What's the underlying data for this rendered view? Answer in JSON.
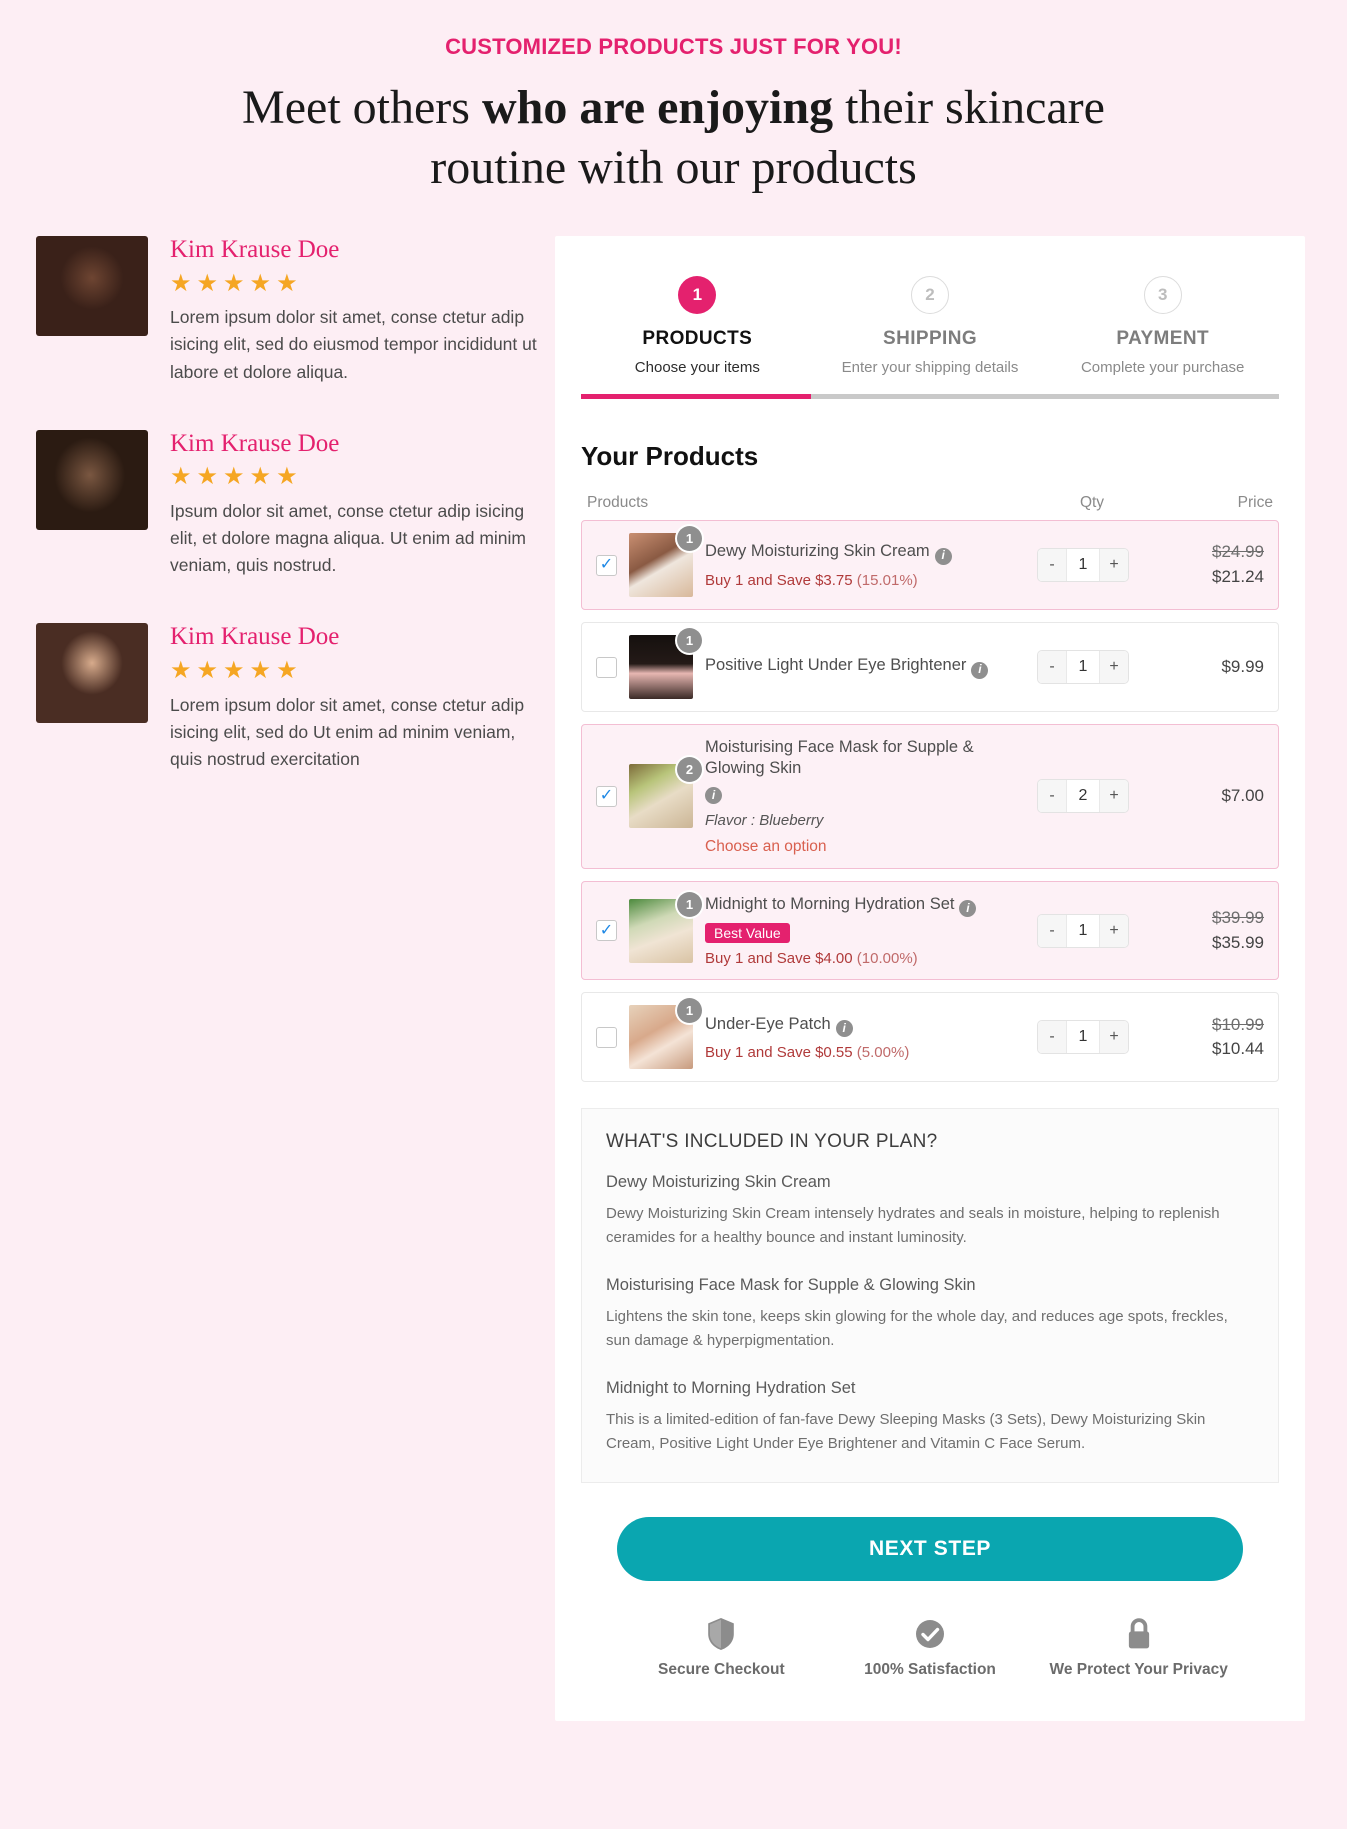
{
  "header": {
    "eyebrow": "CUSTOMIZED PRODUCTS JUST FOR YOU!",
    "headline_part1": "Meet others ",
    "headline_bold": "who are enjoying",
    "headline_part2": " their skincare routine with our products"
  },
  "testimonials": [
    {
      "name": "Kim Krause Doe",
      "stars": "★★★★★",
      "text": "Lorem ipsum dolor sit amet, conse ctetur adip isicing elit, sed do eiusmod tempor incididunt ut labore et dolore aliqua."
    },
    {
      "name": "Kim Krause Doe",
      "stars": "★★★★★",
      "text": "Ipsum dolor sit amet, conse ctetur adip isicing elit, et dolore magna aliqua. Ut enim ad minim veniam, quis nostrud."
    },
    {
      "name": "Kim Krause Doe",
      "stars": "★★★★★",
      "text": "Lorem ipsum dolor sit amet, conse ctetur adip isicing elit, sed do Ut enim ad minim veniam, quis nostrud exercitation"
    }
  ],
  "steps": [
    {
      "number": "1",
      "title": "PRODUCTS",
      "subtitle": "Choose your items"
    },
    {
      "number": "2",
      "title": "SHIPPING",
      "subtitle": "Enter your shipping details"
    },
    {
      "number": "3",
      "title": "PAYMENT",
      "subtitle": "Complete your purchase"
    }
  ],
  "progress_percent": 33,
  "products_section": {
    "title": "Your Products",
    "columns": {
      "products": "Products",
      "qty": "Qty",
      "price": "Price"
    }
  },
  "products": [
    {
      "name": "Dewy Moisturizing Skin Cream",
      "badge_qty": "1",
      "selected": true,
      "save_text": "Buy 1 and Save $3.75",
      "save_pct": "(15.01%)",
      "qty": "1",
      "price_old": "$24.99",
      "price_new": "$21.24"
    },
    {
      "name": "Positive Light Under Eye Brightener",
      "badge_qty": "1",
      "selected": false,
      "qty": "1",
      "price_new": "$9.99"
    },
    {
      "name": "Moisturising Face Mask for Supple & Glowing Skin",
      "badge_qty": "2",
      "selected": true,
      "flavor_label": "Flavor :",
      "flavor_value": "Blueberry",
      "choose_option": "Choose an option",
      "qty": "2",
      "price_new": "$7.00"
    },
    {
      "name": "Midnight to Morning Hydration Set",
      "badge_qty": "1",
      "selected": true,
      "tag": "Best Value",
      "save_text": "Buy 1 and Save $4.00",
      "save_pct": "(10.00%)",
      "qty": "1",
      "price_old": "$39.99",
      "price_new": "$35.99"
    },
    {
      "name": "Under-Eye Patch",
      "badge_qty": "1",
      "selected": false,
      "save_text": "Buy 1 and Save $0.55",
      "save_pct": "(5.00%)",
      "qty": "1",
      "price_old": "$10.99",
      "price_new": "$10.44"
    }
  ],
  "plan": {
    "heading": "WHAT'S INCLUDED IN YOUR PLAN?",
    "items": [
      {
        "name": "Dewy Moisturizing Skin Cream",
        "description": "Dewy Moisturizing Skin Cream intensely hydrates and seals in moisture, helping to replenish ceramides for a healthy bounce and instant luminosity."
      },
      {
        "name": "Moisturising Face Mask for Supple & Glowing Skin",
        "description": "Lightens the skin tone, keeps skin glowing for the whole day, and reduces age spots, freckles, sun damage & hyperpigmentation."
      },
      {
        "name": "Midnight to Morning Hydration Set",
        "description": "This is a limited-edition of fan-fave Dewy Sleeping Masks (3 Sets), Dewy Moisturizing Skin Cream, Positive Light Under Eye Brightener and Vitamin C Face Serum."
      }
    ]
  },
  "cta_label": "NEXT STEP",
  "trust": [
    {
      "icon": "shield-icon",
      "label": "Secure Checkout"
    },
    {
      "icon": "check-circle-icon",
      "label": "100% Satisfaction"
    },
    {
      "icon": "lock-icon",
      "label": "We Protect Your Privacy"
    }
  ],
  "stepper_controls": {
    "minus": "-",
    "plus": "+"
  },
  "colors": {
    "accent_pink": "#e4216e",
    "cta_teal": "#0aa6b0",
    "star_orange": "#f5a623",
    "page_bg": "#fdeef4"
  }
}
